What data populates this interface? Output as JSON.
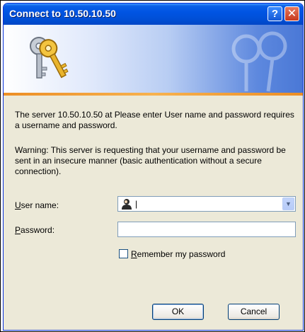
{
  "window": {
    "title": "Connect to 10.50.10.50",
    "help_glyph": "?",
    "close_glyph": "✕"
  },
  "message": {
    "line1": "The server 10.50.10.50 at Please enter User name and password requires a username and password.",
    "warning": "Warning: This server is requesting that your username and password be sent in an insecure manner (basic authentication without a secure connection)."
  },
  "form": {
    "user_label_accel": "U",
    "user_label_rest": "ser name:",
    "user_value": "|",
    "password_label_accel": "P",
    "password_label_rest": "assword:",
    "password_value": "",
    "remember_accel": "R",
    "remember_rest": "emember my password",
    "remember_checked": false
  },
  "buttons": {
    "ok": "OK",
    "cancel": "Cancel"
  },
  "icons": {
    "banner": "keys-icon",
    "user": "user-icon",
    "dropdown": "chevron-down-icon"
  },
  "colors": {
    "titlebar": "#0054e3",
    "banner_accent": "#ec8e25",
    "dialog_bg": "#ece9d8"
  }
}
